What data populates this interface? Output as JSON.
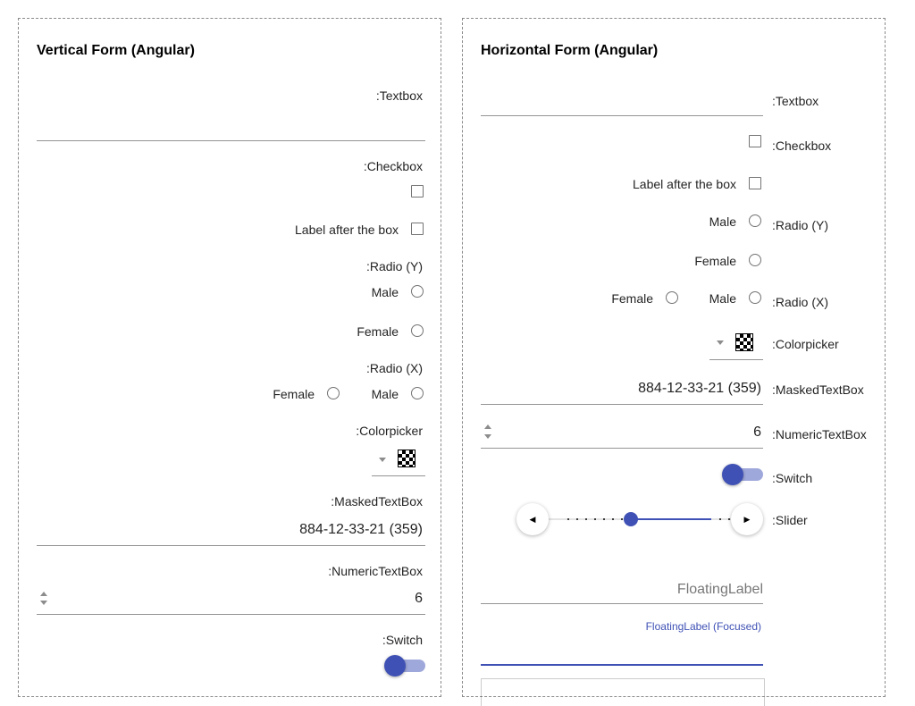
{
  "vertical_form": {
    "title": "Vertical Form (Angular)",
    "textbox_label": ":Textbox",
    "textbox_value": "",
    "checkbox_label": ":Checkbox",
    "checkbox_after_label": "Label after the box",
    "radio_y_label": ":Radio (Y)",
    "radio_y_options": [
      "Male",
      "Female"
    ],
    "radio_x_label": ":Radio (X)",
    "radio_x_options": [
      "Female",
      "Male"
    ],
    "colorpicker_label": ":Colorpicker",
    "masked_label": ":MaskedTextBox",
    "masked_value": "884-12-33-21 (359)",
    "numeric_label": ":NumericTextBox",
    "numeric_value": "6",
    "switch_label": ":Switch",
    "switch_on": true
  },
  "horizontal_form": {
    "title": "Horizontal Form (Angular)",
    "textbox_label": ":Textbox",
    "textbox_value": "",
    "checkbox_label": ":Checkbox",
    "checkbox_after_label": "Label after the box",
    "radio_y_label": ":Radio (Y)",
    "radio_y_options": [
      "Male",
      "Female"
    ],
    "radio_x_label": ":Radio (X)",
    "radio_x_options": [
      "Female",
      "Male"
    ],
    "colorpicker_label": ":Colorpicker",
    "masked_label": ":MaskedTextBox",
    "masked_value": "884-12-33-21 (359)",
    "numeric_label": ":NumericTextBox",
    "numeric_value": "6",
    "switch_label": ":Switch",
    "switch_on": true,
    "slider_label": ":Slider",
    "floating_label": "FloatingLabel",
    "floating_label_focused": "FloatingLabel (Focused)"
  },
  "colors": {
    "accent": "#3f51b5",
    "accent_light": "#9fa8da",
    "border_dashed": "#8a8a8a"
  },
  "icons": {
    "slider_decrease": "caret-left-icon",
    "slider_increase": "caret-right-icon",
    "dropdown": "caret-down-icon"
  }
}
